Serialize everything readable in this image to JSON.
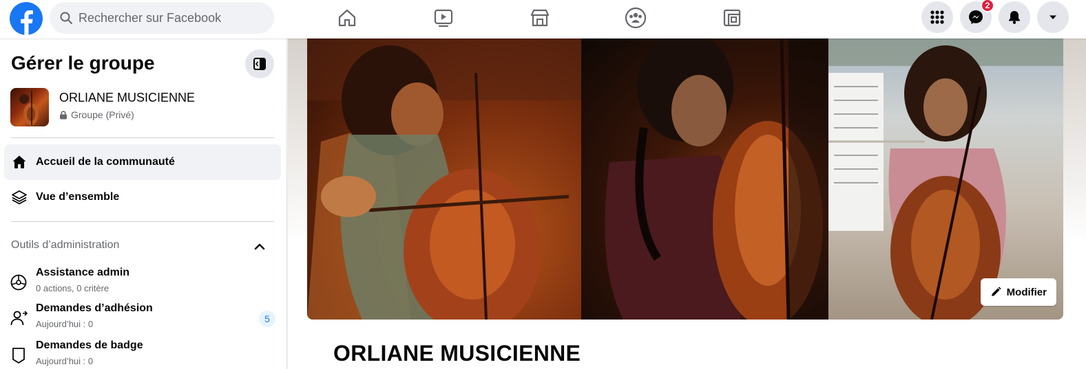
{
  "topbar": {
    "search": {
      "placeholder": "Rechercher sur Facebook"
    },
    "nav": [
      {
        "name": "home-icon"
      },
      {
        "name": "watch-icon"
      },
      {
        "name": "marketplace-icon"
      },
      {
        "name": "groups-icon"
      },
      {
        "name": "gaming-icon"
      }
    ],
    "menu_icon": "grid-menu-icon",
    "messenger_badge": "2",
    "colors": {
      "brand": "#1877f2",
      "badge": "#e41e3f"
    }
  },
  "sidebar": {
    "title": "Gérer le groupe",
    "group": {
      "name": "ORLIANE MUSICIENNE",
      "privacy": "Groupe (Privé)"
    },
    "menu": [
      {
        "label": "Accueil de la communauté",
        "icon": "home-icon",
        "active": true
      },
      {
        "label": "Vue d’ensemble",
        "icon": "layers-icon",
        "active": false
      }
    ],
    "admin_section": {
      "title": "Outils d’administration",
      "items": [
        {
          "title": "Assistance admin",
          "subtitle": "0 actions, 0 critère",
          "icon": "admin-assist-icon"
        },
        {
          "title": "Demandes d’adhésion",
          "subtitle": "Aujourd’hui : 0",
          "count": "5",
          "icon": "member-request-icon"
        },
        {
          "title": "Demandes de badge",
          "subtitle": "Aujourd’hui : 0",
          "icon": "badge-icon"
        }
      ]
    }
  },
  "main": {
    "cover_button": "Modifier",
    "group_title": "ORLIANE MUSICIENNE"
  }
}
